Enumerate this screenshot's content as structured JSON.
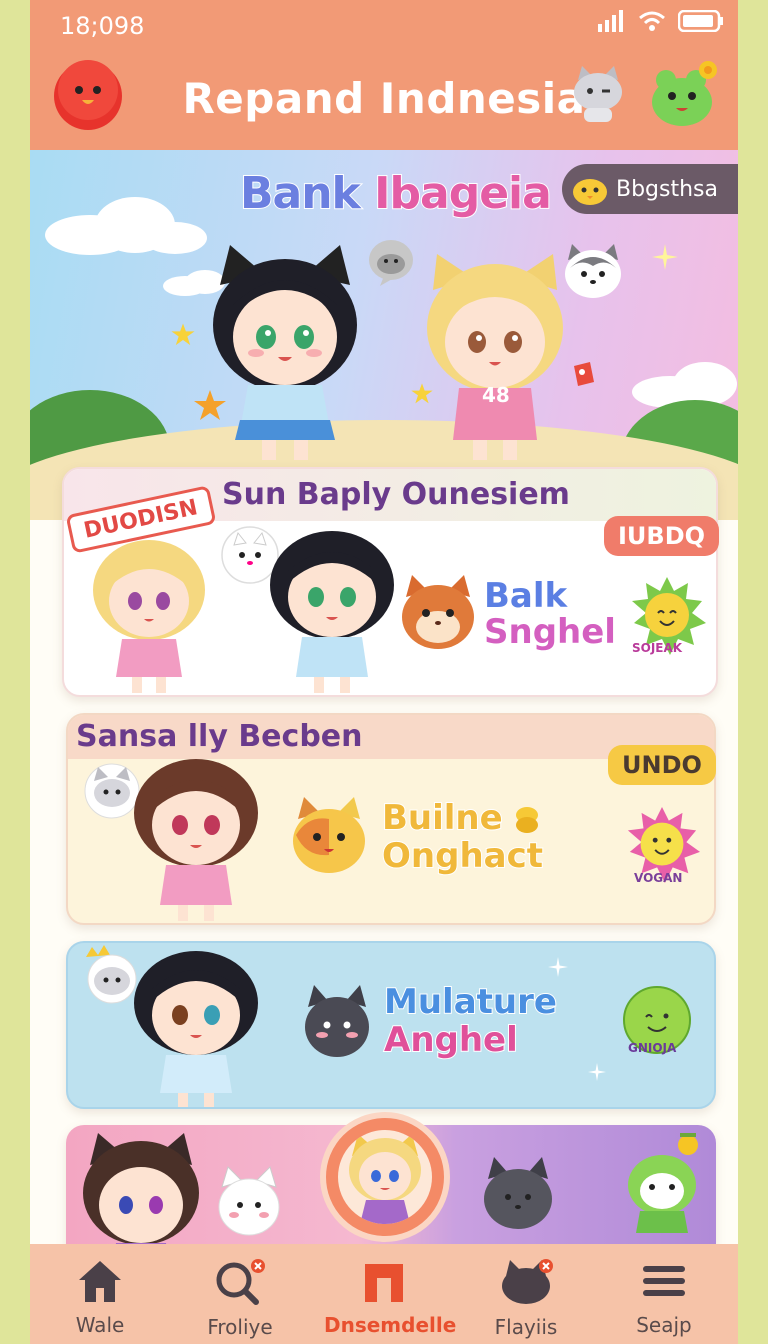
{
  "status": {
    "time": "18;098"
  },
  "header": {
    "title": "Repand Indnesia"
  },
  "hero": {
    "title_part1": "Bank",
    "title_part2": "Ibageia",
    "badge": "Bbgsthsa",
    "shirt_number": "48"
  },
  "card1": {
    "title": "Sun Baply Ounesiem",
    "stamp": "DUODISN",
    "tag": "IUBDQ",
    "word1": "Balk",
    "word2": "Snghel",
    "sun_text": "SOJEAK"
  },
  "card2": {
    "title": "Sansa lly Becben",
    "tag": "UNDO",
    "word1": "Builne",
    "word2": "Onghact",
    "sun_text": "VOGAN"
  },
  "card3": {
    "word1": "Mulature",
    "word2": "Anghel",
    "ball_text": "GNIOJA"
  },
  "nav": {
    "items": [
      {
        "label": "Wale",
        "icon": "home-icon"
      },
      {
        "label": "Froliye",
        "icon": "search-icon"
      },
      {
        "label": "Dnsemdelle",
        "icon": "shop-icon"
      },
      {
        "label": "Flayiis",
        "icon": "cat-icon"
      },
      {
        "label": "Seajp",
        "icon": "menu-icon"
      }
    ]
  },
  "colors": {
    "header": "#f29a76",
    "accent": "#e8502f",
    "nav": "#f6c3a8"
  }
}
